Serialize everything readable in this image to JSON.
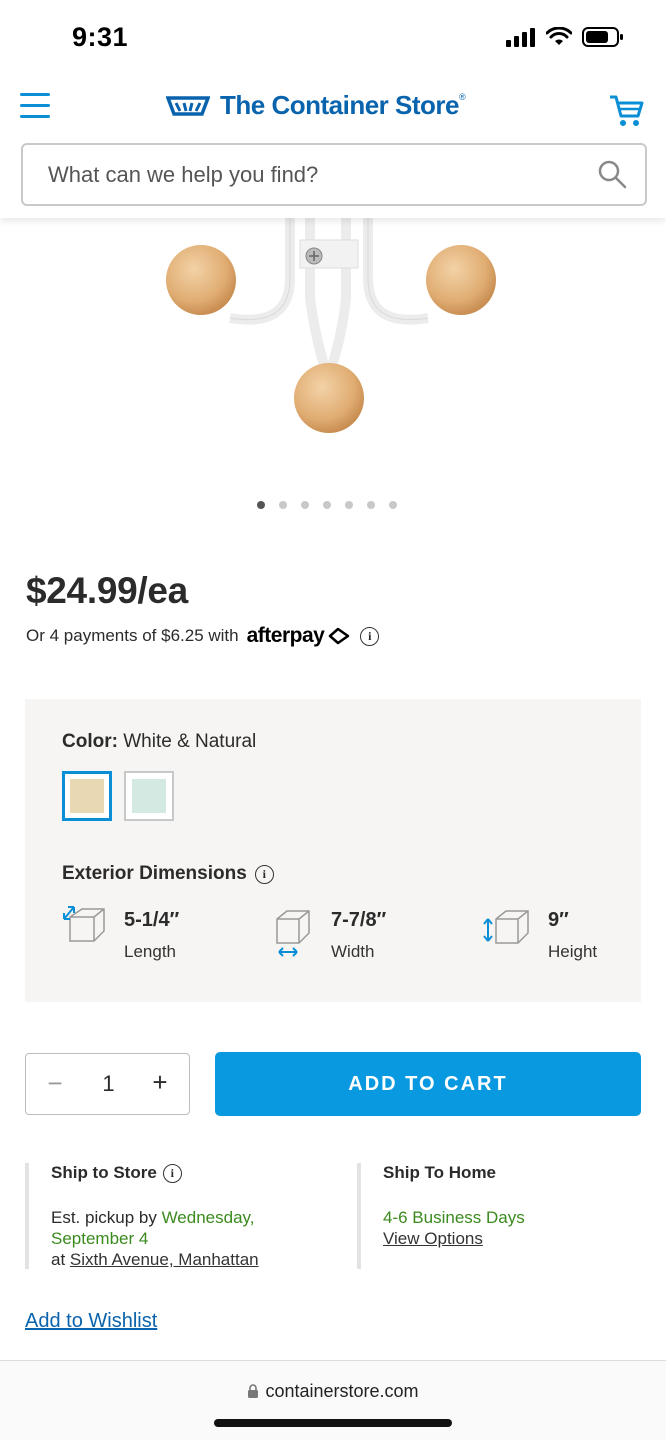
{
  "status_bar": {
    "time": "9:31"
  },
  "header": {
    "brand": "The Container Store",
    "brand_mark": "®",
    "search_placeholder": "What can we help you find?"
  },
  "gallery": {
    "dot_count": 7,
    "active_index": 0
  },
  "product": {
    "price": "$24.99/ea",
    "afterpay_text": "Or 4 payments of $6.25 with",
    "afterpay_brand": "afterpay"
  },
  "options": {
    "color_label": "Color:",
    "color_value": "White & Natural",
    "swatches": [
      {
        "color": "#e9d8b4",
        "selected": true
      },
      {
        "color": "#d5e9e3",
        "selected": false
      }
    ],
    "dimensions_title": "Exterior Dimensions",
    "dimensions": [
      {
        "value": "5-1/4″",
        "label": "Length"
      },
      {
        "value": "7-7/8″",
        "label": "Width"
      },
      {
        "value": "9″",
        "label": "Height"
      }
    ]
  },
  "cart": {
    "quantity": "1",
    "minus": "−",
    "plus": "+",
    "add_label": "ADD TO CART"
  },
  "shipping": {
    "store": {
      "title": "Ship to Store",
      "pickup_prefix": "Est. pickup by ",
      "pickup_date_1": "Wednesday,",
      "pickup_date_2": "September 4",
      "at": "at ",
      "location": "Sixth Avenue, Manhattan"
    },
    "home": {
      "title": "Ship To Home",
      "days": "4-6 Business Days",
      "link": "View Options"
    }
  },
  "wishlist": "Add to Wishlist",
  "url_bar": {
    "url": "containerstore.com"
  },
  "colors": {
    "accent": "#0999e0",
    "brand": "#0a63ad",
    "green": "#3b8a1e"
  }
}
